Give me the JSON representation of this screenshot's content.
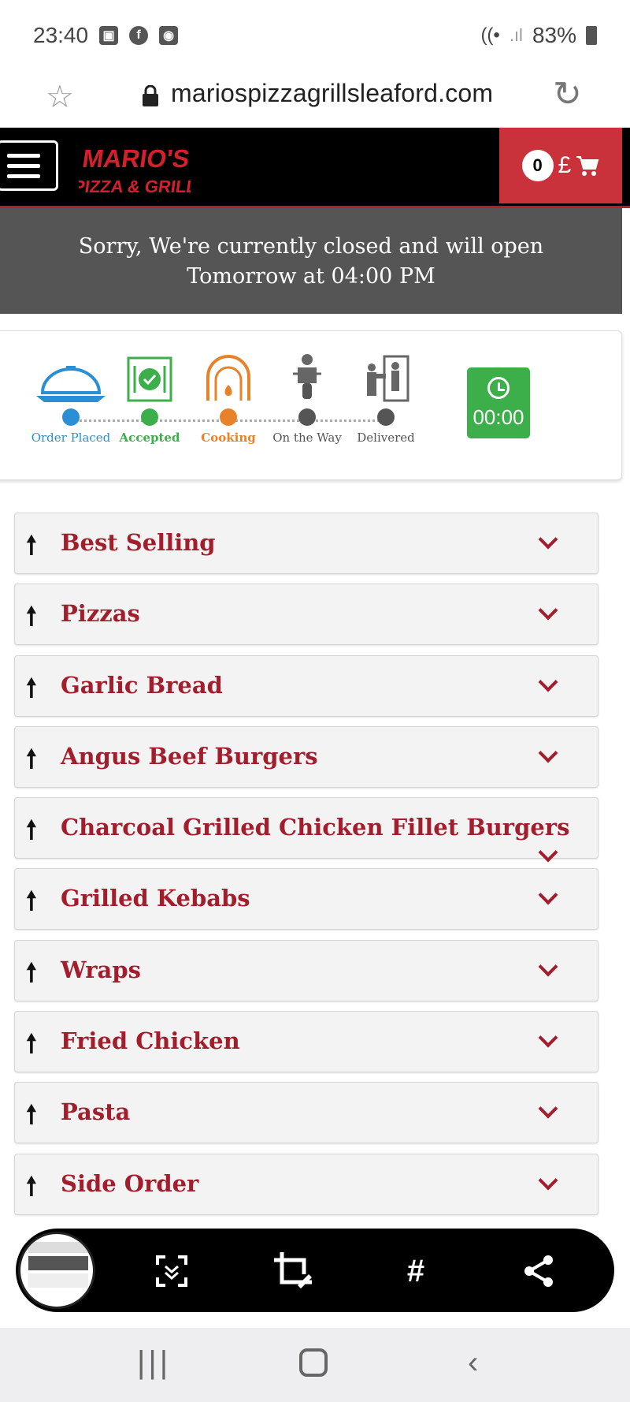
{
  "status_bar": {
    "time": "23:40",
    "battery": "83%"
  },
  "browser": {
    "url": "mariospizzagrillsleaford.com"
  },
  "header": {
    "logo_line1": "MARIO'S",
    "logo_line2": "PIZZA & GRILL",
    "cart_count": "0",
    "currency": "£"
  },
  "notice": {
    "line1": "Sorry, We're currently closed and will open",
    "line2": "Tomorrow at 04:00 PM"
  },
  "tracker": {
    "steps": [
      {
        "label": "Order Placed",
        "color": "#2b8fd6"
      },
      {
        "label": "Accepted",
        "color": "#3cae4a"
      },
      {
        "label": "Cooking",
        "color": "#e8822a"
      },
      {
        "label": "On the Way",
        "color": "#555555"
      },
      {
        "label": "Delivered",
        "color": "#555555"
      }
    ],
    "timer": "00:00"
  },
  "menu": {
    "categories": [
      "Best Selling",
      "Pizzas",
      "Garlic Bread",
      "Angus Beef Burgers",
      "Charcoal Grilled Chicken Fillet Burgers",
      "Grilled Kebabs",
      "Wraps",
      "Fried Chicken",
      "Pasta",
      "Side Order"
    ]
  },
  "share_bar": {
    "icons": [
      "scroll-capture-icon",
      "crop-edit-icon",
      "hashtag-icon",
      "share-icon"
    ]
  },
  "nav_bar": {
    "icons": [
      "recent-apps-icon",
      "home-icon",
      "back-icon"
    ]
  },
  "colors": {
    "brand_red": "#a31e2c",
    "cart_red": "#c9323a",
    "header_black": "#000000",
    "notice_grey": "#555555"
  }
}
